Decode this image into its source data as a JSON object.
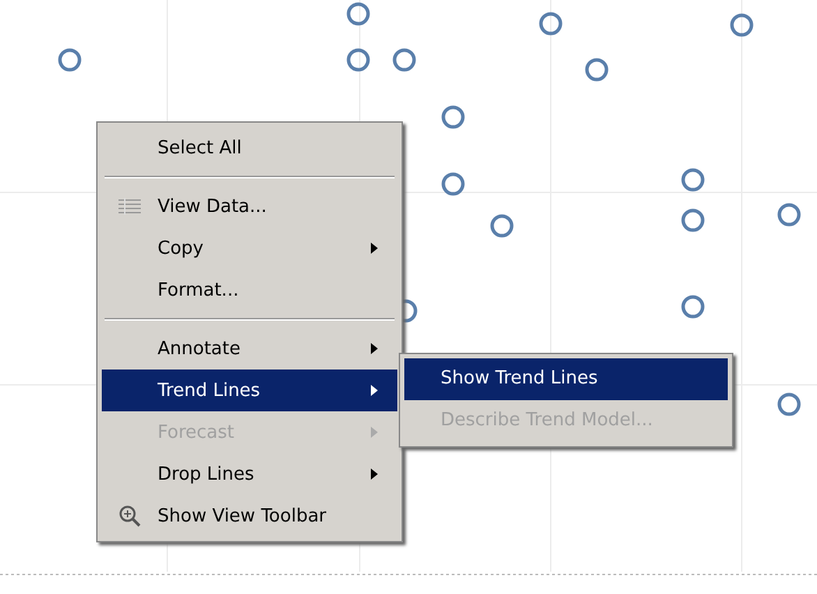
{
  "context_menu": {
    "items": [
      {
        "kind": "command",
        "label": "Select All",
        "submenu_arrow": false,
        "disabled": false,
        "selected": false
      },
      {
        "kind": "separator"
      },
      {
        "kind": "table-command",
        "label": "View Data...",
        "submenu_arrow": false,
        "disabled": false,
        "selected": false
      },
      {
        "kind": "command",
        "label": "Copy",
        "submenu_arrow": true,
        "disabled": false,
        "selected": false
      },
      {
        "kind": "command",
        "label": "Format...",
        "submenu_arrow": false,
        "disabled": false,
        "selected": false
      },
      {
        "kind": "separator"
      },
      {
        "kind": "command",
        "label": "Annotate",
        "submenu_arrow": true,
        "disabled": false,
        "selected": false
      },
      {
        "kind": "command",
        "label": "Trend Lines",
        "submenu_arrow": true,
        "disabled": false,
        "selected": true,
        "submenu": [
          {
            "label": "Show Trend Lines",
            "disabled": false,
            "selected": true
          },
          {
            "label": "Describe Trend Model...",
            "disabled": true,
            "selected": false
          }
        ]
      },
      {
        "kind": "command",
        "label": "Forecast",
        "submenu_arrow": true,
        "disabled": true,
        "selected": false
      },
      {
        "kind": "command",
        "label": "Drop Lines",
        "submenu_arrow": true,
        "disabled": false,
        "selected": false
      },
      {
        "kind": "zoom-command",
        "label": "Show View Toolbar",
        "submenu_arrow": false,
        "disabled": false,
        "selected": false
      }
    ]
  }
}
